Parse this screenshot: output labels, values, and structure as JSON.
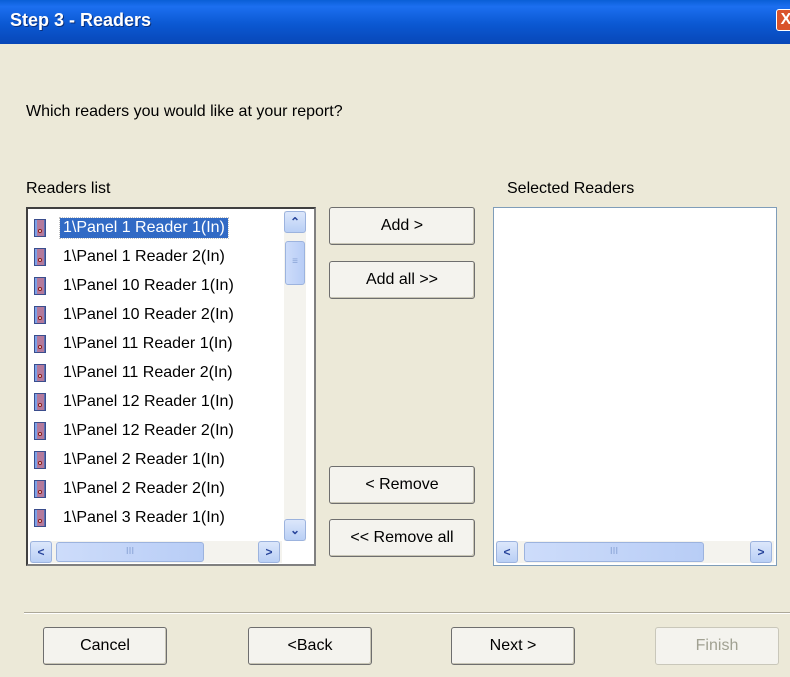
{
  "window": {
    "title": "Step 3 - Readers",
    "close_glyph": "X"
  },
  "question": "Which readers you would like at your report?",
  "readers_list": {
    "label": "Readers list",
    "items": [
      "1\\Panel 1 Reader 1(In)",
      "1\\Panel 1 Reader 2(In)",
      "1\\Panel 10 Reader 1(In)",
      "1\\Panel 10 Reader 2(In)",
      "1\\Panel 11 Reader 1(In)",
      "1\\Panel 11 Reader 2(In)",
      "1\\Panel 12 Reader 1(In)",
      "1\\Panel 12 Reader 2(In)",
      "1\\Panel 2 Reader 1(In)",
      "1\\Panel 2 Reader 2(In)",
      "1\\Panel 3 Reader 1(In)"
    ],
    "selected_index": 0,
    "item_icon": "reader-icon"
  },
  "selected_readers": {
    "label": "Selected Readers",
    "items": []
  },
  "buttons": {
    "add": "Add >",
    "add_all": "Add all >>",
    "remove": "< Remove",
    "remove_all": "<< Remove all"
  },
  "scroll_glyphs": {
    "up": "⌃",
    "down": "⌄",
    "left": "<",
    "right": ">",
    "grip": "III",
    "vgrip": "≡"
  },
  "footer": {
    "cancel": "Cancel",
    "back": "<Back",
    "next": "Next >",
    "finish": "Finish"
  },
  "colors": {
    "titlebar": "#0b58d2",
    "selection": "#316ac5",
    "dialog_bg": "#ece9d8"
  }
}
